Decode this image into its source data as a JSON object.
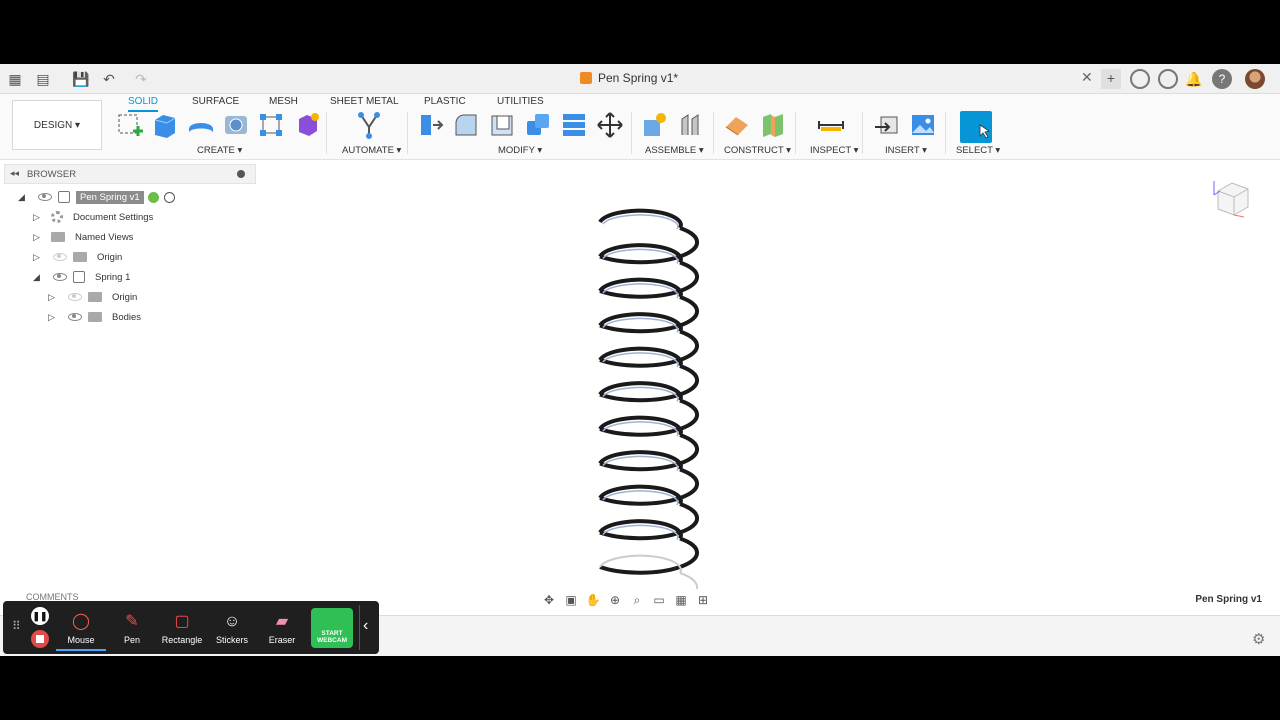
{
  "window": {
    "doc_title": "Pen Spring v1*"
  },
  "toolbar": {
    "design_label": "DESIGN",
    "tabs": [
      "SOLID",
      "SURFACE",
      "MESH",
      "SHEET METAL",
      "PLASTIC",
      "UTILITIES"
    ],
    "groups": [
      "CREATE",
      "AUTOMATE",
      "MODIFY",
      "ASSEMBLE",
      "CONSTRUCT",
      "INSPECT",
      "INSERT",
      "SELECT"
    ]
  },
  "browser": {
    "title": "BROWSER",
    "items": [
      {
        "label": "Pen Spring v1"
      },
      {
        "label": "Document Settings"
      },
      {
        "label": "Named Views"
      },
      {
        "label": "Origin"
      },
      {
        "label": "Spring 1"
      },
      {
        "label": "Origin"
      },
      {
        "label": "Bodies"
      }
    ]
  },
  "viewport": {
    "doc_name": "Pen Spring v1"
  },
  "comments_label": "COMMENTS",
  "recorder": {
    "items": [
      {
        "label": "Mouse"
      },
      {
        "label": "Pen"
      },
      {
        "label": "Rectangle"
      },
      {
        "label": "Stickers"
      },
      {
        "label": "Eraser"
      }
    ],
    "webcam_label": "START WEBCAM"
  },
  "colors": {
    "accent": "#0696d7",
    "webcam": "#2fbf54"
  }
}
